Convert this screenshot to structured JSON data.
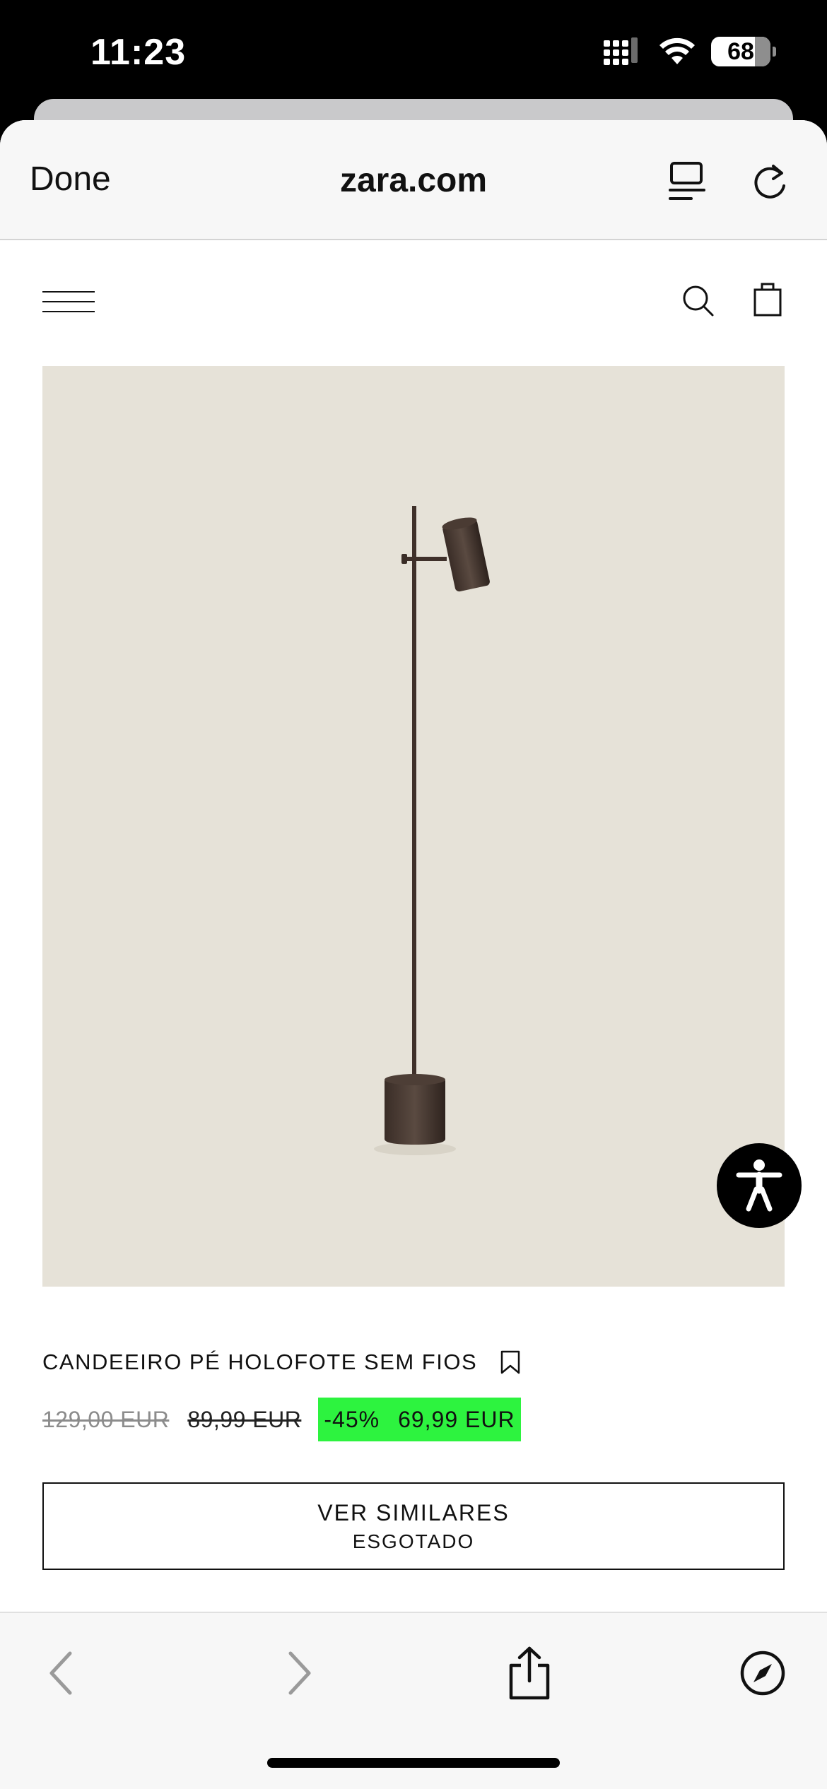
{
  "status_bar": {
    "time": "11:23",
    "battery_level": "68",
    "icons": [
      "cellular-signal-icon",
      "wifi-icon",
      "battery-icon"
    ]
  },
  "browser": {
    "done_label": "Done",
    "site": "zara.com",
    "icons": [
      "reader-mode-icon",
      "reload-icon"
    ]
  },
  "page": {
    "icons": [
      "menu-icon",
      "search-icon",
      "shopping-bag-icon",
      "bookmark-icon",
      "accessibility-icon"
    ],
    "product": {
      "name": "CANDEEIRO PÉ HOLOFOTE SEM FIOS",
      "price_original": "129,00 EUR",
      "price_previous": "89,99 EUR",
      "discount": "-45%",
      "price_current": "69,99 EUR",
      "image_background": "#e6e2d8"
    },
    "similar_button": {
      "label": "VER SIMILARES",
      "status": "ESGOTADO"
    },
    "sale_color": "#2df33f"
  },
  "toolbar": {
    "icons": [
      "back-arrow-icon",
      "forward-arrow-icon",
      "share-icon",
      "compass-icon"
    ]
  }
}
